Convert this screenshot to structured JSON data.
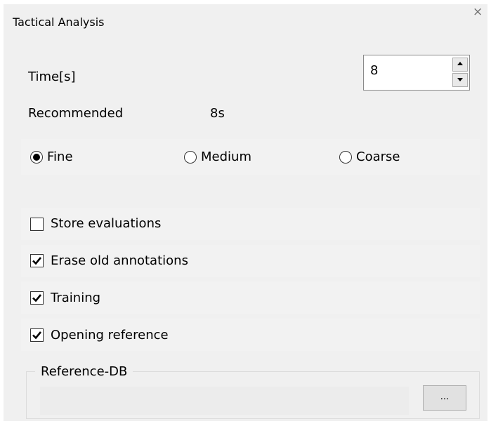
{
  "dialog": {
    "title": "Tactical Analysis",
    "close_glyph": "×",
    "icons": [
      "close-icon",
      "spin-up-icon",
      "spin-down-icon",
      "checkmark-icon"
    ]
  },
  "time": {
    "label": "Time[s]",
    "value": "8"
  },
  "recommended": {
    "label": "Recommended",
    "value": "8s"
  },
  "resolution": {
    "options": [
      {
        "label": "Fine",
        "selected": true
      },
      {
        "label": "Medium",
        "selected": false
      },
      {
        "label": "Coarse",
        "selected": false
      }
    ]
  },
  "options": [
    {
      "label": "Store evaluations",
      "checked": false
    },
    {
      "label": "Erase old annotations",
      "checked": true
    },
    {
      "label": "Training",
      "checked": true
    },
    {
      "label": "Opening reference",
      "checked": true
    }
  ],
  "reference_db": {
    "legend": "Reference-DB",
    "path": "",
    "browse_label": "..."
  }
}
